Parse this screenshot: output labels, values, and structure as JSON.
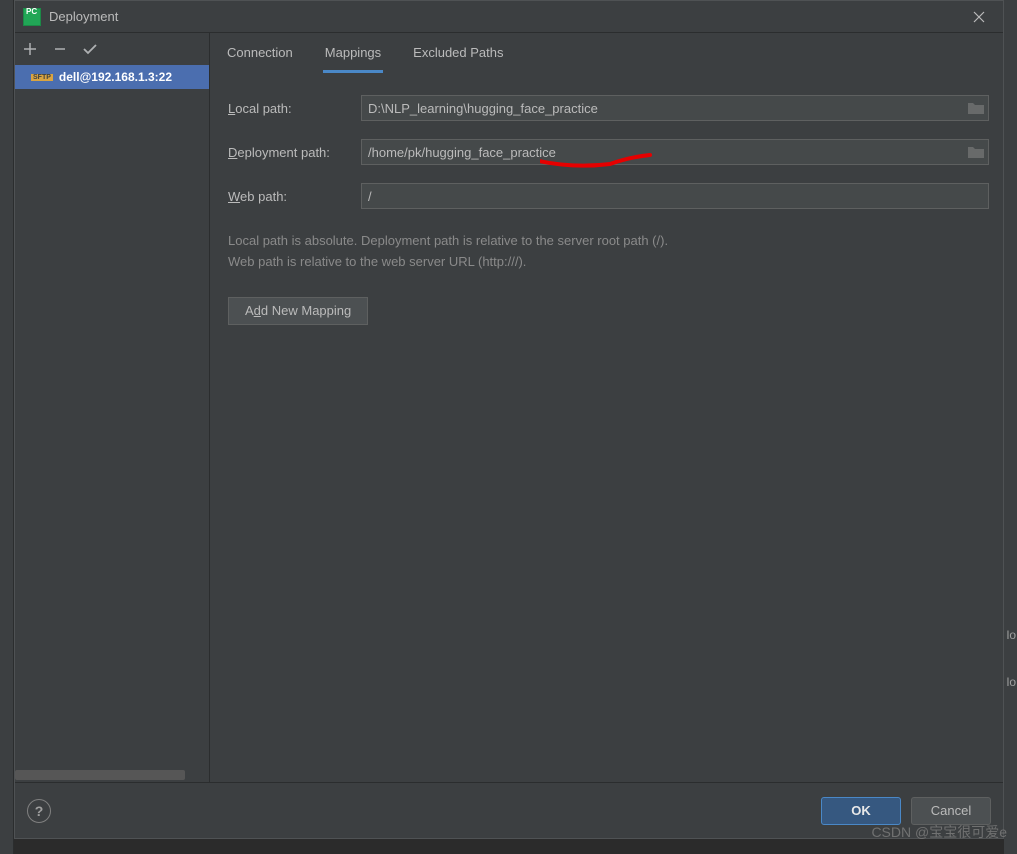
{
  "titlebar": {
    "title": "Deployment"
  },
  "sidebar": {
    "items": [
      {
        "protocol": "SFTP",
        "label": "dell@192.168.1.3:22"
      }
    ]
  },
  "tabs": {
    "connection": "Connection",
    "mappings": "Mappings",
    "excluded": "Excluded Paths",
    "active": "mappings"
  },
  "form": {
    "local_path_label_pre": "L",
    "local_path_label_mn": "ocal path:",
    "local_path_value": "D:\\NLP_learning\\hugging_face_practice",
    "deploy_path_label_pre": "D",
    "deploy_path_label_mn": "eployment path:",
    "deploy_path_value": "/home/pk/hugging_face_practice",
    "web_path_label_pre": "W",
    "web_path_label_mn": "eb path:",
    "web_path_value": "/",
    "help_line1": "Local path is absolute. Deployment path is relative to the server root path (/).",
    "help_line2": "Web path is relative to the web server URL (http:///).",
    "add_mapping_pre": "A",
    "add_mapping_mn": "d",
    "add_mapping_post": "d New Mapping"
  },
  "footer": {
    "ok": "OK",
    "cancel": "Cancel"
  },
  "watermark": "CSDN @宝宝很可爱e"
}
